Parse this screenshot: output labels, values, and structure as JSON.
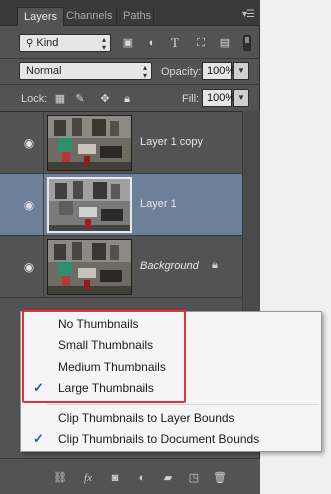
{
  "tabs": [
    {
      "label": "Layers",
      "active": true
    },
    {
      "label": "Channels",
      "active": false
    },
    {
      "label": "Paths",
      "active": false
    }
  ],
  "filter": {
    "kind_label": "Kind"
  },
  "blend_mode": {
    "value": "Normal"
  },
  "opacity": {
    "label": "Opacity:",
    "value": "100%"
  },
  "lock": {
    "label": "Lock:"
  },
  "fill": {
    "label": "Fill:",
    "value": "100%"
  },
  "layers": [
    {
      "name": "Layer 1 copy",
      "selected": false,
      "italic": false,
      "locked": false
    },
    {
      "name": "Layer 1",
      "selected": true,
      "italic": false,
      "locked": false
    },
    {
      "name": "Background",
      "selected": false,
      "italic": true,
      "locked": true
    }
  ],
  "context_menu": {
    "items": [
      {
        "label": "No Thumbnails",
        "checked": false
      },
      {
        "label": "Small Thumbnails",
        "checked": false
      },
      {
        "label": "Medium Thumbnails",
        "checked": false
      },
      {
        "label": "Large Thumbnails",
        "checked": true
      },
      {
        "label": "Clip Thumbnails to Layer Bounds",
        "checked": false
      },
      {
        "label": "Clip Thumbnails to Document Bounds",
        "checked": true
      }
    ],
    "checkmark": "✓"
  },
  "colors": {
    "panel_bg": "#535353",
    "selected_layer": "#6d7f99",
    "menu_bg": "#f5f5f5",
    "highlight_border": "#e0333a",
    "check_color": "#2f52c9"
  },
  "icons": {
    "eye": "eye-icon",
    "lock": "lock-icon",
    "search": "search-icon",
    "panel_menu": "panel-menu-icon"
  }
}
